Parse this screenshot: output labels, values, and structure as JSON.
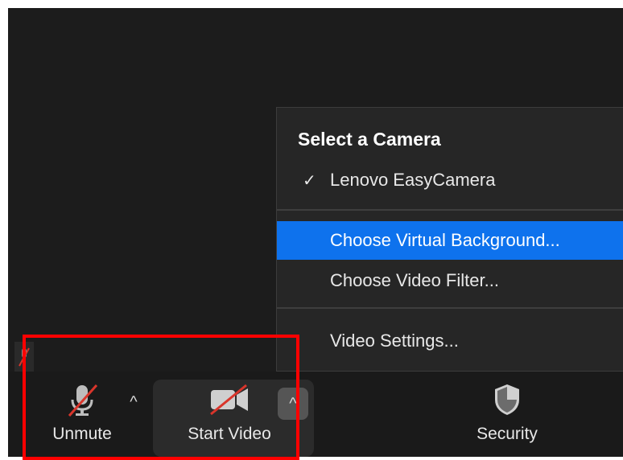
{
  "colors": {
    "background": "#1c1c1c",
    "menu_background": "#262626",
    "selected_item": "#0e72ed",
    "mute_slash": "#d9352b",
    "annotation": "#ff0000"
  },
  "camera_menu": {
    "header": "Select a Camera",
    "items": [
      {
        "label": "Lenovo EasyCamera",
        "checked": true,
        "icon": "checkmark-icon"
      },
      {
        "label": "Choose Virtual Background...",
        "selected": true
      },
      {
        "label": "Choose Video Filter..."
      },
      {
        "label": "Video Settings..."
      }
    ]
  },
  "toolbar": {
    "unmute_label": "Unmute",
    "unmute_icon": "microphone-muted-icon",
    "audio_caret": "^",
    "start_video_label": "Start Video",
    "video_icon": "camera-off-icon",
    "video_caret": "^",
    "security_label": "Security",
    "security_icon": "shield-icon"
  }
}
